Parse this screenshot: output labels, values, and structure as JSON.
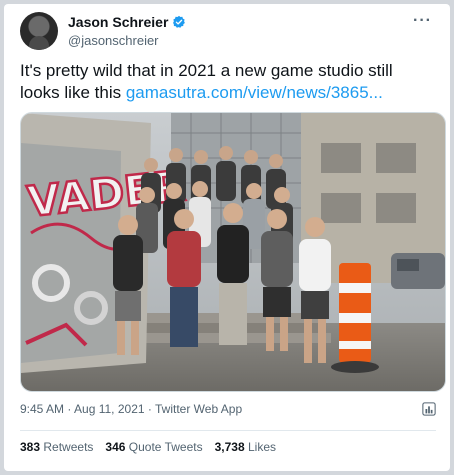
{
  "author": {
    "name": "Jason Schreier",
    "handle": "@jasonschreier",
    "verified": true
  },
  "tweet": {
    "text": "It's pretty wild that in 2021 a new game studio still looks like this ",
    "link_text": "gamasutra.com/view/news/3865..."
  },
  "media": {
    "graffiti_text": "VADER"
  },
  "meta": {
    "timestamp": "9:45 AM · Aug 11, 2021 · Twitter Web App"
  },
  "stats": {
    "retweets_count": "383",
    "retweets_label": "Retweets",
    "quotes_count": "346",
    "quotes_label": "Quote Tweets",
    "likes_count": "3,738",
    "likes_label": "Likes"
  },
  "colors": {
    "accent": "#1d9bf0",
    "text": "#0f1419",
    "muted": "#536471"
  },
  "icons": [
    "verified-badge-icon",
    "more-icon",
    "analytics-icon"
  ]
}
